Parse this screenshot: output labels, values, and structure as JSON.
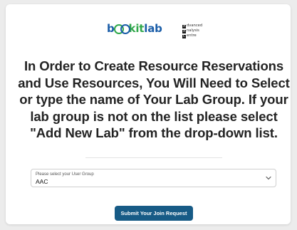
{
  "logos": {
    "bookitlab": {
      "prefix": "b",
      "middle": "kit",
      "suffix": "lab"
    },
    "aac": {
      "line1_initial": "A",
      "line1_rest": "dvanced",
      "line2_initial": "A",
      "line2_rest": "nalysis",
      "line3_initial": "C",
      "line3_rest": "entre"
    }
  },
  "main": {
    "instructions": "In Order to Create Resource Reservations and Use Resources, You Will Need to Select or type the name of Your Lab Group. If your lab group is not on the list please select \"Add New Lab\" from the drop-down list."
  },
  "form": {
    "group_select": {
      "label": "Please select your User Group",
      "value": "AAC"
    },
    "submit_label": "Submit Your Join Request"
  },
  "colors": {
    "brand_blue": "#1a5da8",
    "brand_green": "#30a84a",
    "button": "#175b86"
  }
}
